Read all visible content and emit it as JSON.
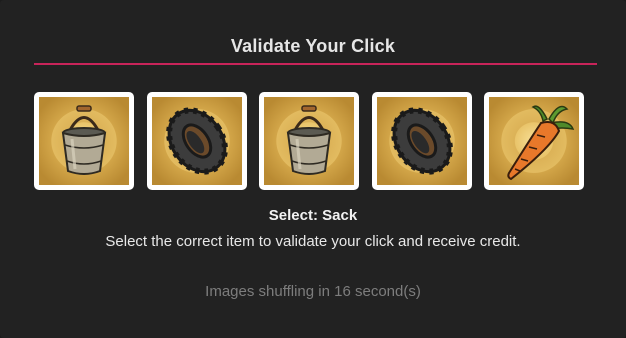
{
  "modal": {
    "title": "Validate Your Click",
    "accent_color": "#c8245a",
    "select_prefix": "Select:",
    "select_target": "Sack",
    "instructions": "Select the correct item to validate your click and receive credit.",
    "shuffle_text": "Images shuffling in 16 second(s)"
  },
  "tiles": [
    {
      "icon": "bucket-icon"
    },
    {
      "icon": "tire-icon"
    },
    {
      "icon": "bucket-icon"
    },
    {
      "icon": "tire-icon"
    },
    {
      "icon": "carrot-icon"
    }
  ]
}
